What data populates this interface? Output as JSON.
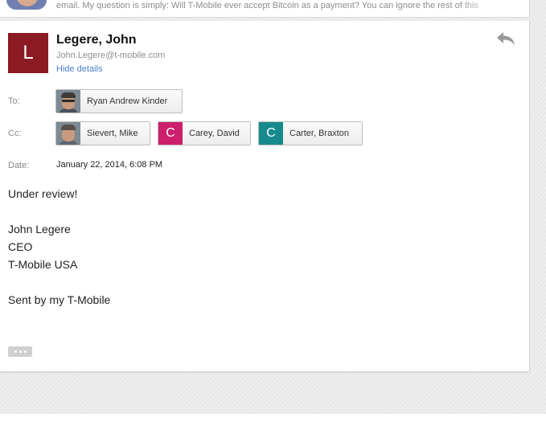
{
  "previous_message": {
    "snippet": "email. My question is simply: Will T-Mobile ever accept Bitcoin as a payment? You can ignore the rest of this"
  },
  "message": {
    "sender": {
      "initial": "L",
      "name": "Legere, John",
      "email": "John.Legere@t-mobile.com",
      "avatar_color": "#8b1a22"
    },
    "hide_details_label": "Hide details",
    "to": {
      "label": "To:",
      "recipients": [
        {
          "name": "Ryan Andrew Kinder",
          "avatar": "photo"
        }
      ]
    },
    "cc": {
      "label": "Cc:",
      "recipients": [
        {
          "name": "Sievert, Mike",
          "avatar": "photo"
        },
        {
          "name": "Carey, David",
          "avatar": "letter",
          "initial": "C",
          "color": "#cc1f6c"
        },
        {
          "name": "Carter, Braxton",
          "avatar": "letter",
          "initial": "C",
          "color": "#178a8e"
        }
      ]
    },
    "date": {
      "label": "Date:",
      "value": "January 22, 2014, 6:08 PM"
    },
    "body": {
      "line1": "Under review!",
      "line2": "John Legere",
      "line3": "CEO",
      "line4": "T-Mobile USA",
      "line5": "Sent by my T-Mobile"
    }
  },
  "icons": {
    "reply": "reply-icon",
    "more": "more-options-icon"
  }
}
